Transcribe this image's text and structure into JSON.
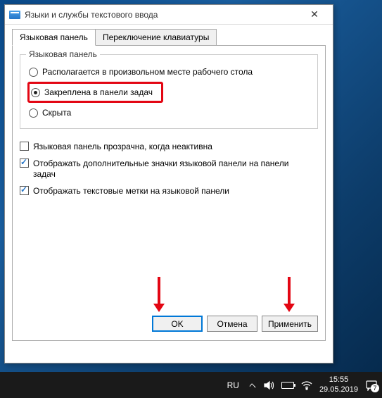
{
  "dialog": {
    "title": "Языки и службы текстового ввода",
    "tabs": [
      {
        "label": "Языковая панель",
        "active": true
      },
      {
        "label": "Переключение клавиатуры",
        "active": false
      }
    ],
    "group": {
      "title": "Языковая панель",
      "radios": [
        {
          "label": "Располагается в произвольном месте рабочего стола",
          "checked": false,
          "highlight": false
        },
        {
          "label": "Закреплена в панели задач",
          "checked": true,
          "highlight": true
        },
        {
          "label": "Скрыта",
          "checked": false,
          "highlight": false
        }
      ]
    },
    "checkboxes": [
      {
        "label": "Языковая панель прозрачна, когда неактивна",
        "checked": false
      },
      {
        "label": "Отображать дополнительные значки языковой панели на панели задач",
        "checked": true
      },
      {
        "label": "Отображать текстовые метки на языковой панели",
        "checked": true
      }
    ],
    "buttons": {
      "ok": "OK",
      "cancel": "Отмена",
      "apply": "Применить"
    }
  },
  "taskbar": {
    "lang": "RU",
    "time": "15:55",
    "date": "29.05.2019",
    "notif_count": "7"
  }
}
